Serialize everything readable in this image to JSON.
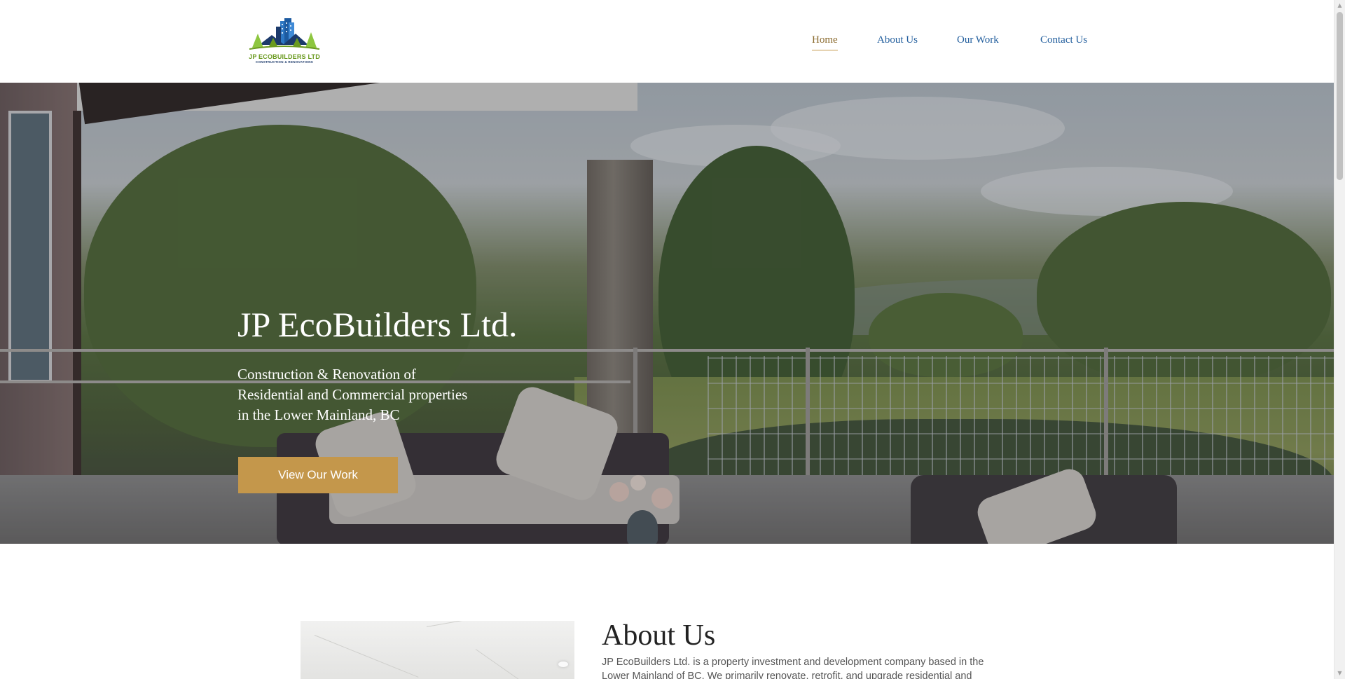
{
  "brand": {
    "logo_alt": "JP Ecobuilders Ltd logo",
    "logo_text": "JP ECOBUILDERS LTD",
    "logo_subtext": "CONSTRUCTION & RENOVATIONS",
    "colors": {
      "green": "#8dc63f",
      "navy": "#1c3a6b",
      "blue": "#2e78c4"
    }
  },
  "nav": {
    "items": [
      {
        "label": "Home",
        "active": true
      },
      {
        "label": "About Us",
        "active": false
      },
      {
        "label": "Our Work",
        "active": false
      },
      {
        "label": "Contact Us",
        "active": false
      }
    ],
    "link_color": "#1f5c9c",
    "active_underline_color": "#c49a4d"
  },
  "hero": {
    "title": "JP EcoBuilders Ltd.",
    "tagline_lines": [
      "Construction & Renovation of",
      "Residential and Commercial properties",
      "in the Lower Mainland, BC"
    ],
    "button_label": "View Our Work",
    "button_color": "#c4974b"
  },
  "about": {
    "title": "About Us",
    "text": "JP EcoBuilders Ltd. is a property investment and development company based in the Lower Mainland of BC. We primarily renovate, retrofit, and upgrade residential and commercial"
  },
  "scrollbar": {
    "up_icon": "triangle-up-icon",
    "down_icon": "triangle-down-icon"
  }
}
